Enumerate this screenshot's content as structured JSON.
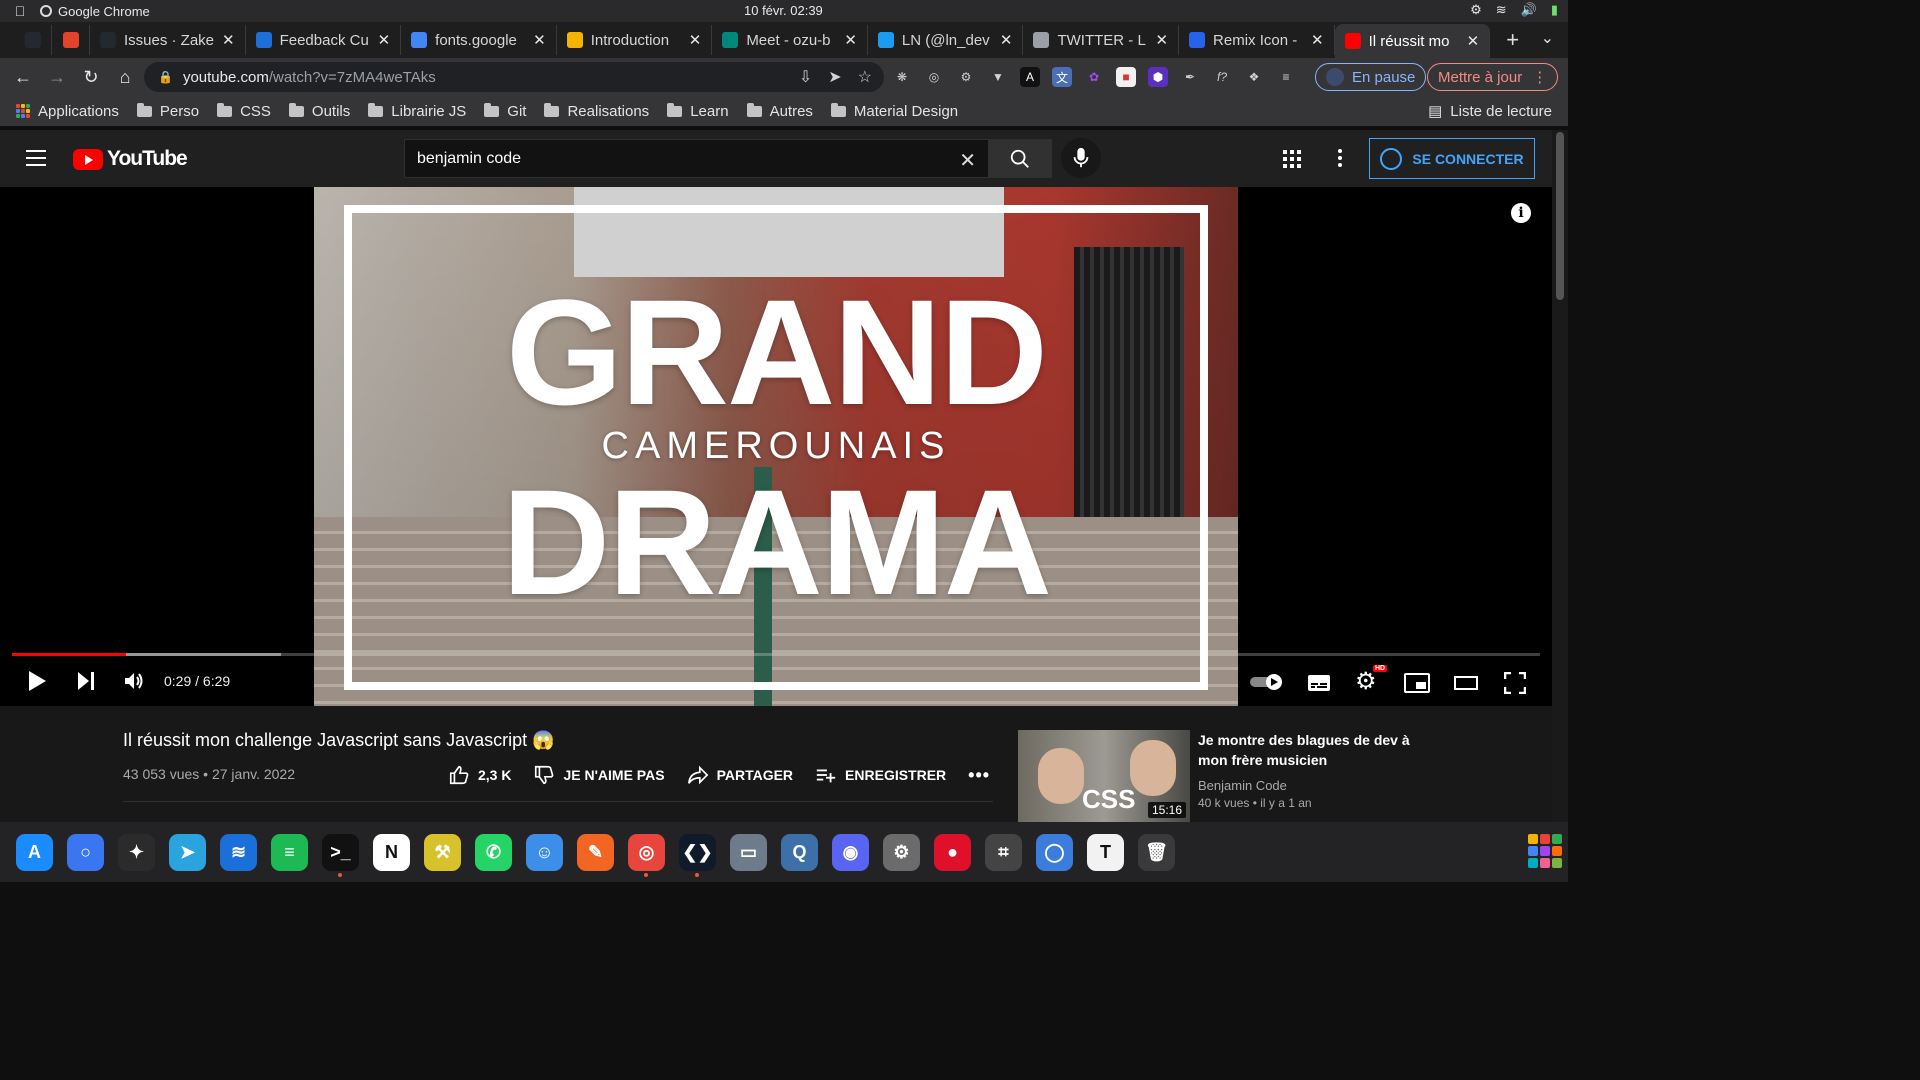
{
  "menubar": {
    "app_name": "Google Chrome",
    "clock": "10 févr.  02:39"
  },
  "tabs": [
    {
      "title": "",
      "color": "#24292f",
      "pinned": true
    },
    {
      "title": "",
      "color": "#e24329",
      "pinned": true
    },
    {
      "title": "Issues · Zakeo",
      "color": "#24292f"
    },
    {
      "title": "Feedback Cu",
      "color": "#1e6fd9"
    },
    {
      "title": "fonts.google",
      "color": "#4285f4"
    },
    {
      "title": "Introduction",
      "color": "#f4b400"
    },
    {
      "title": "Meet - ozu-b",
      "color": "#00897b"
    },
    {
      "title": "LN (@ln_dev",
      "color": "#1d9bf0"
    },
    {
      "title": "TWITTER - L",
      "color": "#9aa0a6"
    },
    {
      "title": "Remix Icon -",
      "color": "#2563eb"
    },
    {
      "title": "Il réussit mo",
      "color": "#ff0000",
      "active": true
    }
  ],
  "toolbar": {
    "url_host": "youtube.com",
    "url_path": "/watch?v=7zMA4weTAks",
    "profile_label": "En pause",
    "update_label": "Mettre à jour"
  },
  "bookmarks": {
    "apps_label": "Applications",
    "folders": [
      "Perso",
      "CSS",
      "Outils",
      "Librairie JS",
      "Git",
      "Realisations",
      "Learn",
      "Autres",
      "Material Design"
    ],
    "reading_list": "Liste de lecture"
  },
  "youtube": {
    "logo_text": "YouTube",
    "search_value": "benjamin code",
    "signin_label": "SE CONNECTER"
  },
  "player": {
    "thumb_line1": "GRAND",
    "thumb_line2": "CAMEROUNAIS",
    "thumb_line3": "DRAMA",
    "time_display": "0:29 / 6:29",
    "played_fraction": 0.0746,
    "buffered_fraction": 0.176,
    "hd_badge": "HD"
  },
  "video": {
    "title": "Il réussit mon challenge Javascript sans Javascript 😱",
    "meta": "43 053 vues • 27 janv. 2022",
    "likes": "2,3 K",
    "dislike_label": "JE N'AIME PAS",
    "share_label": "PARTAGER",
    "save_label": "ENREGISTRER"
  },
  "recommendation": {
    "title": "Je montre des blagues de dev à mon frère musicien",
    "channel": "Benjamin Code",
    "meta": "40 k vues • il y a 1 an",
    "duration": "15:16",
    "badge": "CSS"
  },
  "dock": [
    {
      "name": "app-store",
      "color": "#1a8cff",
      "glyph": "A"
    },
    {
      "name": "signal",
      "color": "#3a76f0",
      "glyph": "○"
    },
    {
      "name": "figma",
      "color": "#2b2b2b",
      "glyph": "✦"
    },
    {
      "name": "telegram",
      "color": "#2aa3df",
      "glyph": "➤"
    },
    {
      "name": "activity",
      "color": "#1b6fd8",
      "glyph": "≋"
    },
    {
      "name": "spotify",
      "color": "#1db954",
      "glyph": "≡"
    },
    {
      "name": "terminal",
      "color": "#111111",
      "glyph": ">_"
    },
    {
      "name": "notion",
      "color": "#ffffff",
      "glyph": "N"
    },
    {
      "name": "xcode-tools",
      "color": "#d8c22b",
      "glyph": "⚒"
    },
    {
      "name": "whatsapp",
      "color": "#25d366",
      "glyph": "✆"
    },
    {
      "name": "finder",
      "color": "#3c8ee8",
      "glyph": "☺"
    },
    {
      "name": "vectornator",
      "color": "#f26522",
      "glyph": "✎"
    },
    {
      "name": "chrome",
      "color": "#e8453c",
      "glyph": "◎"
    },
    {
      "name": "vscode",
      "color": "#0f1b2a",
      "glyph": "❮❯"
    },
    {
      "name": "preview",
      "color": "#6d7b8a",
      "glyph": "▭"
    },
    {
      "name": "quicktime",
      "color": "#3d6fa8",
      "glyph": "Q"
    },
    {
      "name": "discord",
      "color": "#5865f2",
      "glyph": "◉"
    },
    {
      "name": "system-settings",
      "color": "#6b6b6b",
      "glyph": "⚙"
    },
    {
      "name": "recorder",
      "color": "#e0102b",
      "glyph": "●"
    },
    {
      "name": "screenshot",
      "color": "#444444",
      "glyph": "⌗"
    },
    {
      "name": "browser",
      "color": "#3b7ddd",
      "glyph": "◯"
    },
    {
      "name": "typora",
      "color": "#f2f2f2",
      "glyph": "T"
    },
    {
      "name": "trash",
      "color": "#3a3a3c",
      "glyph": "🗑"
    }
  ]
}
